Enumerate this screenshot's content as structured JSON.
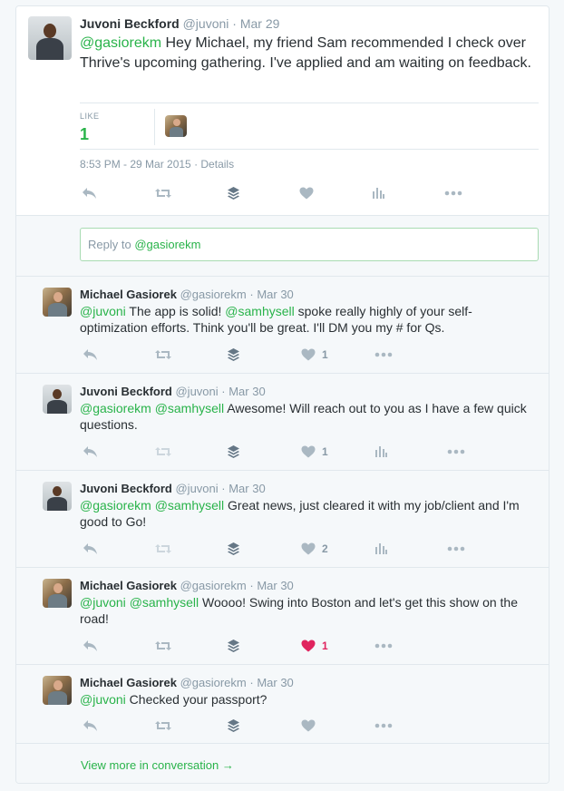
{
  "colors": {
    "accent": "#29b34a",
    "liked": "#e0245e",
    "muted": "#8899a6",
    "icon": "#aab8c2"
  },
  "main_tweet": {
    "name": "Juvoni Beckford",
    "handle": "@juvoni",
    "date": "· Mar 29",
    "mention": "@gasiorekm",
    "text": " Hey Michael, my friend Sam recommended I check over Thrive's upcoming gathering. I've applied and am waiting on feedback.",
    "like_label": "LIKE",
    "like_count": "1",
    "timestamp": "8:53 PM - 29 Mar 2015 · Details",
    "icons": [
      "reply-icon",
      "retweet-icon",
      "buffer-stack-icon",
      "like-heart-icon",
      "analytics-icon",
      "more-dots-icon"
    ]
  },
  "reply_box": {
    "prefix": "Reply to ",
    "mention": "@gasiorekm"
  },
  "replies": [
    {
      "name": "Michael Gasiorek",
      "handle": "@gasiorekm",
      "date": "· Mar 30",
      "mention1": "@juvoni",
      "text1": " The app is solid! ",
      "mention2": "@samhysell",
      "text2": " spoke really highly of your self-optimization efforts. Think you'll be great. I'll DM you my # for Qs.",
      "like_count": "1",
      "liked": false
    },
    {
      "name": "Juvoni Beckford",
      "handle": "@juvoni",
      "date": "· Mar 30",
      "mention1": "@gasiorekm",
      "text1": " ",
      "mention2": "@samhysell",
      "text2": " Awesome! Will reach out to you as I have a few quick questions.",
      "like_count": "1",
      "liked": false
    },
    {
      "name": "Juvoni Beckford",
      "handle": "@juvoni",
      "date": "· Mar 30",
      "mention1": "@gasiorekm",
      "text1": " ",
      "mention2": "@samhysell",
      "text2": " Great news, just cleared it with my job/client and I'm good to Go!",
      "like_count": "2",
      "liked": false
    },
    {
      "name": "Michael Gasiorek",
      "handle": "@gasiorekm",
      "date": "· Mar 30",
      "mention1": "@juvoni",
      "text1": " ",
      "mention2": "@samhysell",
      "text2": " Woooo! Swing into Boston and let's get this show on the road!",
      "like_count": "1",
      "liked": true
    },
    {
      "name": "Michael Gasiorek",
      "handle": "@gasiorekm",
      "date": "· Mar 30",
      "mention1": "@juvoni",
      "text1": " Checked your passport?",
      "mention2": "",
      "text2": "",
      "like_count": "",
      "liked": false
    }
  ],
  "view_more": "View more in conversation →"
}
